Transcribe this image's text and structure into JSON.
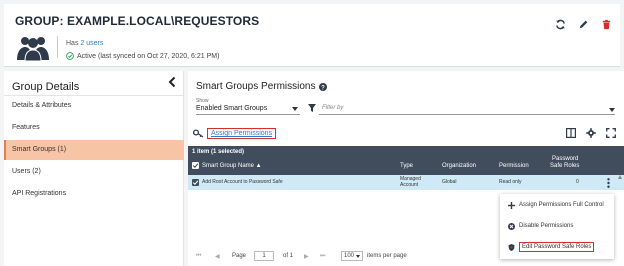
{
  "header": {
    "title": "GROUP: EXAMPLE.LOCAL\\REQUESTORS",
    "has_prefix": "Has",
    "users_link": "2 users",
    "status": "Active (last synced on Oct 27, 2020, 6:21 PM)",
    "icons": [
      "refresh-icon",
      "edit-icon",
      "delete-icon"
    ],
    "accent_color": "#d62d2d"
  },
  "sidebar": {
    "title": "Group Details",
    "items": [
      {
        "label": "Details & Attributes",
        "active": false
      },
      {
        "label": "Features",
        "active": false
      },
      {
        "label": "Smart Groups (1)",
        "active": true
      },
      {
        "label": "Users (2)",
        "active": false
      },
      {
        "label": "API Registrations",
        "active": false
      }
    ],
    "active_color": "#f7c4a6"
  },
  "main": {
    "title": "Smart Groups Permissions",
    "show_label": "Show",
    "show_value": "Enabled Smart Groups",
    "filter_placeholder": "Filter by",
    "assign_label": "Assign Permissions"
  },
  "grid": {
    "selection_count": "1 item (1 selected)",
    "columns": {
      "name": "Smart Group Name ▲",
      "type": "Type",
      "organization": "Organization",
      "permission": "Permission",
      "roles_line1": "Password",
      "roles_line2": "Safe Roles"
    },
    "rows": [
      {
        "name": "Add Root Account to Password Safe",
        "type_line1": "Managed",
        "type_line2": "Account",
        "organization": "Global",
        "permission": "Read only",
        "roles": "0"
      }
    ],
    "header_color": "#414d5c",
    "row_color": "#cfe9f6"
  },
  "context_menu": {
    "items": [
      {
        "label": "Assign Permissions Full Control",
        "icon": "plus-icon"
      },
      {
        "label": "Disable Permissions",
        "icon": "ban-icon"
      },
      {
        "label": "Edit Password Safe Roles",
        "icon": "shield-icon"
      }
    ]
  },
  "pager": {
    "first": "⏮",
    "prev": "◀",
    "page_label": "Page",
    "page_value": "1",
    "of_label": "of 1",
    "next": "▶",
    "last": "⏭",
    "per_page_value": "100",
    "per_page_label": "items per page"
  }
}
